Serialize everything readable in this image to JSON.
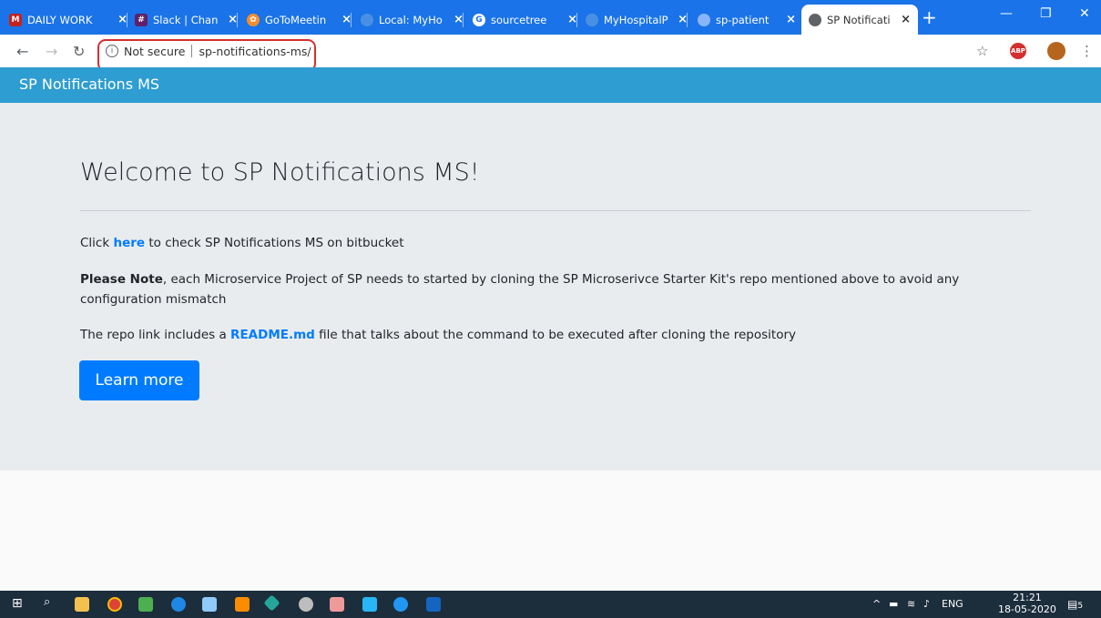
{
  "browser": {
    "tabs": [
      {
        "label": "DAILY WORK",
        "favicon_color": "#c5221f"
      },
      {
        "label": "Slack | Chan",
        "favicon_color": "#611f69"
      },
      {
        "label": "GoToMeetin",
        "favicon_color": "#f68d2e"
      },
      {
        "label": "Local: MyHo",
        "favicon_color": "#4a90e2"
      },
      {
        "label": "sourcetree",
        "favicon_color": "#ffffff"
      },
      {
        "label": "MyHospitalP",
        "favicon_color": "#4a90e2"
      },
      {
        "label": "sp-patient",
        "favicon_color": "#8ab4f8"
      },
      {
        "label": "SP Notificati",
        "favicon_color": "#5f6368",
        "active": true
      }
    ],
    "address": {
      "security_text": "Not secure",
      "url": "sp-notifications-ms/"
    },
    "colors": {
      "tabbar": "#1a73e8",
      "highlight": "#d32f2f"
    }
  },
  "navbar": {
    "brand": "SP Notifications MS",
    "color": "#2e9dd1"
  },
  "jumbotron": {
    "title": "Welcome to SP Notifications MS!",
    "line1_prefix": "Click ",
    "line1_link": "here",
    "line1_suffix": " to check SP Notifications MS on bitbucket",
    "note_bold": "Please Note",
    "note_text_1": ", each Microservice Project of SP needs to started by cloning the SP Microserivce Starter Kit's repo mentioned above to avoid any",
    "note_text_2": "configuration mismatch",
    "repo_prefix": "The repo link includes a ",
    "repo_link": "README.md",
    "repo_suffix": " file that talks about the command to be executed after cloning the repository",
    "button_label": "Learn more",
    "button_color": "#007bff"
  },
  "taskbar": {
    "tray_lang": "ENG",
    "time": "21:21",
    "date": "18-05-2020",
    "notifications": "5"
  }
}
